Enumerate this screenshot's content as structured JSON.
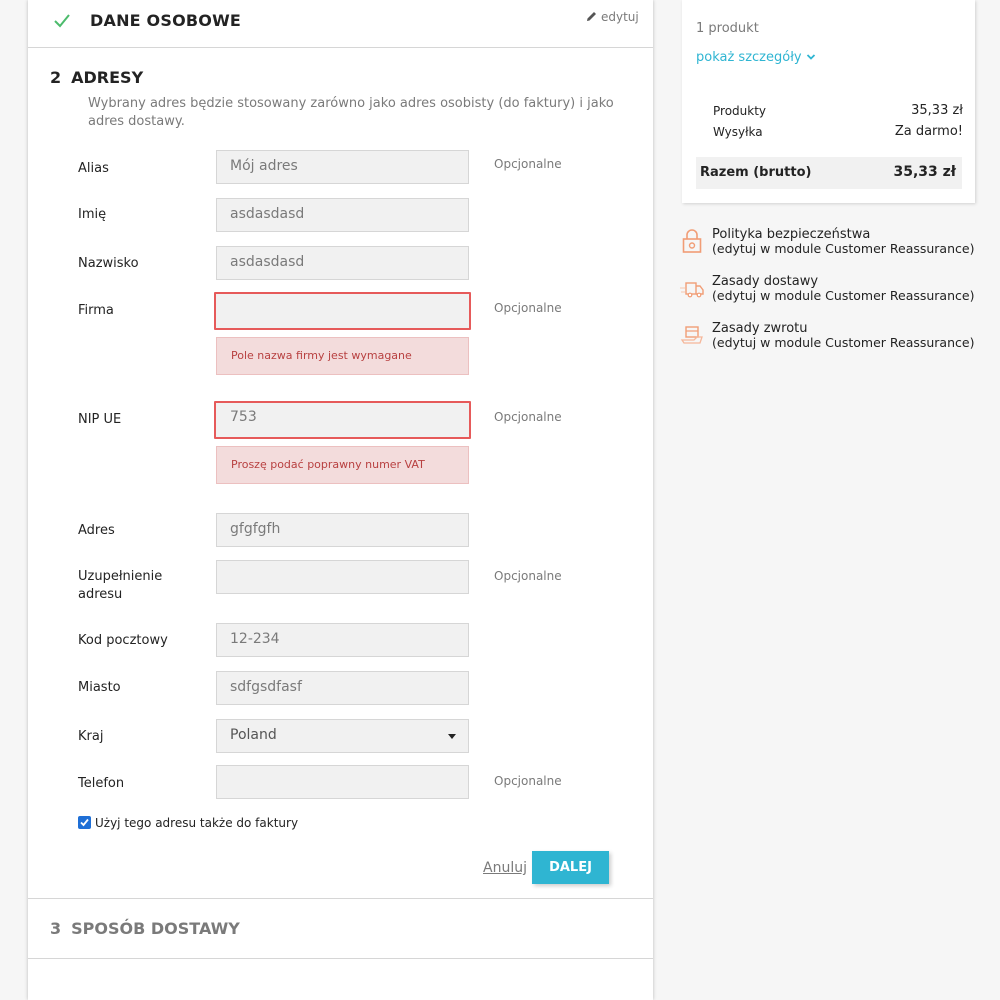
{
  "personal": {
    "title": "DANE OSOBOWE",
    "edit": "edytuj"
  },
  "addresses": {
    "number": "2",
    "title": "ADRESY",
    "description": "Wybrany adres będzie stosowany zarówno jako adres osobisty (do faktury) i jako adres dostawy."
  },
  "form": {
    "alias": {
      "label": "Alias",
      "placeholder": "Mój adres",
      "optional": "Opcjonalne"
    },
    "firstname": {
      "label": "Imię",
      "value": "asdasdasd"
    },
    "lastname": {
      "label": "Nazwisko",
      "value": "asdasdasd"
    },
    "company": {
      "label": "Firma",
      "value": "",
      "optional": "Opcjonalne",
      "error": "Pole nazwa firmy jest wymagane"
    },
    "vat": {
      "label": "NIP UE",
      "value": "753",
      "optional": "Opcjonalne",
      "error": "Proszę podać poprawny numer VAT"
    },
    "address1": {
      "label": "Adres",
      "value": "gfgfgfh"
    },
    "address2": {
      "label_line1": "Uzupełnienie",
      "label_line2": "adresu",
      "value": "",
      "optional": "Opcjonalne"
    },
    "postcode": {
      "label": "Kod pocztowy",
      "value": "12-234"
    },
    "city": {
      "label": "Miasto",
      "value": "sdfgsdfasf"
    },
    "country": {
      "label": "Kraj",
      "value": "Poland"
    },
    "phone": {
      "label": "Telefon",
      "value": "",
      "optional": "Opcjonalne"
    },
    "use_for_invoice": "Użyj tego adresu także do faktury",
    "cancel": "Anuluj",
    "next": "DALEJ"
  },
  "shipping": {
    "number": "3",
    "title": "SPOSÓB DOSTAWY"
  },
  "summary": {
    "count": "1 produkt",
    "details_link": "pokaż szczegóły",
    "products_label": "Produkty",
    "products_value": "35,33 zł",
    "shipping_label": "Wysyłka",
    "shipping_value": "Za darmo!",
    "total_label": "Razem (brutto)",
    "total_value": "35,33 zł"
  },
  "reassurance": [
    {
      "title": "Polityka bezpieczeństwa",
      "note": "(edytuj w module Customer Reassurance)",
      "icon": "security-lock-icon"
    },
    {
      "title": "Zasady dostawy",
      "note": "(edytuj w module Customer Reassurance)",
      "icon": "delivery-truck-icon"
    },
    {
      "title": "Zasady zwrotu",
      "note": "(edytuj w module Customer Reassurance)",
      "icon": "return-package-icon"
    }
  ],
  "colors": {
    "accent": "#2fb5d2",
    "error_border": "#e65a5a",
    "error_bg": "#f3dcdc",
    "checkmark": "#4cbb6c"
  }
}
